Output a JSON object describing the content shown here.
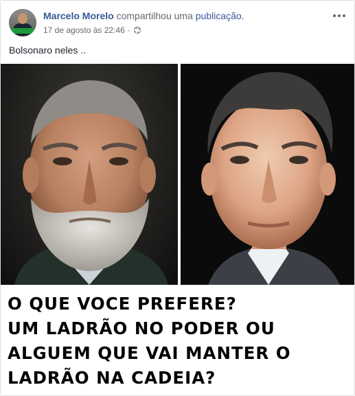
{
  "post": {
    "author_name": "Marcelo Morelo",
    "action_verb": "compartilhou uma",
    "action_object": "publicação.",
    "timestamp": "17 de agosto às 22:46",
    "separator": "·",
    "privacy_icon": "globe-icon",
    "more_icon": "ellipsis-icon",
    "text": "Bolsonaro neles .."
  },
  "image": {
    "left_photo": "portrait of a grey-bearded man in a dark suit",
    "right_photo": "portrait of a dark-haired man in a suit and tie",
    "caption_lines": [
      "O QUE VOCE PREFERE?",
      "UM LADRÃO NO PODER OU",
      "ALGUEM QUE VAI MANTER O",
      "LADRÃO NA CADEIA?"
    ]
  },
  "colors": {
    "link": "#385898",
    "meta": "#616770",
    "text": "#1d2129",
    "border": "#dddfe2"
  }
}
